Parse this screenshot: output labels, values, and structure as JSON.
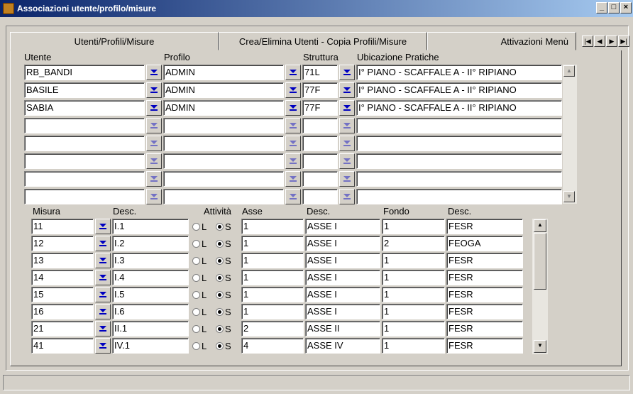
{
  "window": {
    "title": "Associazioni utente/profilo/misure"
  },
  "tabs": [
    {
      "label": "Utenti/Profili/Misure"
    },
    {
      "label": "Crea/Elimina Utenti - Copia Profili/Misure"
    },
    {
      "label": "Attivazioni Menù"
    }
  ],
  "users_table": {
    "headers": {
      "utente": "Utente",
      "profilo": "Profilo",
      "struttura": "Struttura",
      "ubicazione": "Ubicazione Pratiche"
    },
    "rows": [
      {
        "utente": "RB_BANDI",
        "profilo": "ADMIN",
        "struttura": "71L",
        "ubicazione": "I° PIANO - SCAFFALE A - II° RIPIANO"
      },
      {
        "utente": "BASILE",
        "profilo": "ADMIN",
        "struttura": "77F",
        "ubicazione": "I° PIANO - SCAFFALE A - II° RIPIANO"
      },
      {
        "utente": "SABIA",
        "profilo": "ADMIN",
        "struttura": "77F",
        "ubicazione": "I° PIANO - SCAFFALE A - II° RIPIANO"
      },
      {
        "utente": "",
        "profilo": "",
        "struttura": "",
        "ubicazione": ""
      },
      {
        "utente": "",
        "profilo": "",
        "struttura": "",
        "ubicazione": ""
      },
      {
        "utente": "",
        "profilo": "",
        "struttura": "",
        "ubicazione": ""
      },
      {
        "utente": "",
        "profilo": "",
        "struttura": "",
        "ubicazione": ""
      },
      {
        "utente": "",
        "profilo": "",
        "struttura": "",
        "ubicazione": ""
      }
    ]
  },
  "misure_table": {
    "headers": {
      "misura": "Misura",
      "desc1": "Desc.",
      "attivita": "Attività",
      "asse": "Asse",
      "desc2": "Desc.",
      "fondo": "Fondo",
      "desc3": "Desc."
    },
    "radio_labels": {
      "l": "L",
      "s": "S"
    },
    "rows": [
      {
        "misura": "11",
        "desc1": "I.1",
        "attivita": "S",
        "asse": "1",
        "desc2": "ASSE I",
        "fondo": "1",
        "desc3": "FESR"
      },
      {
        "misura": "12",
        "desc1": "I.2",
        "attivita": "S",
        "asse": "1",
        "desc2": "ASSE I",
        "fondo": "2",
        "desc3": "FEOGA"
      },
      {
        "misura": "13",
        "desc1": "I.3",
        "attivita": "S",
        "asse": "1",
        "desc2": "ASSE I",
        "fondo": "1",
        "desc3": "FESR"
      },
      {
        "misura": "14",
        "desc1": "I.4",
        "attivita": "S",
        "asse": "1",
        "desc2": "ASSE I",
        "fondo": "1",
        "desc3": "FESR"
      },
      {
        "misura": "15",
        "desc1": "I.5",
        "attivita": "S",
        "asse": "1",
        "desc2": "ASSE I",
        "fondo": "1",
        "desc3": "FESR"
      },
      {
        "misura": "16",
        "desc1": "I.6",
        "attivita": "S",
        "asse": "1",
        "desc2": "ASSE I",
        "fondo": "1",
        "desc3": "FESR"
      },
      {
        "misura": "21",
        "desc1": "II.1",
        "attivita": "S",
        "asse": "2",
        "desc2": "ASSE II",
        "fondo": "1",
        "desc3": "FESR"
      },
      {
        "misura": "41",
        "desc1": "IV.1",
        "attivita": "S",
        "asse": "4",
        "desc2": "ASSE IV",
        "fondo": "1",
        "desc3": "FESR"
      }
    ]
  },
  "colors": {
    "titlebar_start": "#0a246a",
    "titlebar_end": "#a6caf0",
    "dropdown_arrow": "#0000c0",
    "window_bg": "#d4d0c8"
  },
  "icons": {
    "dropdown": "chevron-down-icon",
    "app": "app-icon"
  }
}
